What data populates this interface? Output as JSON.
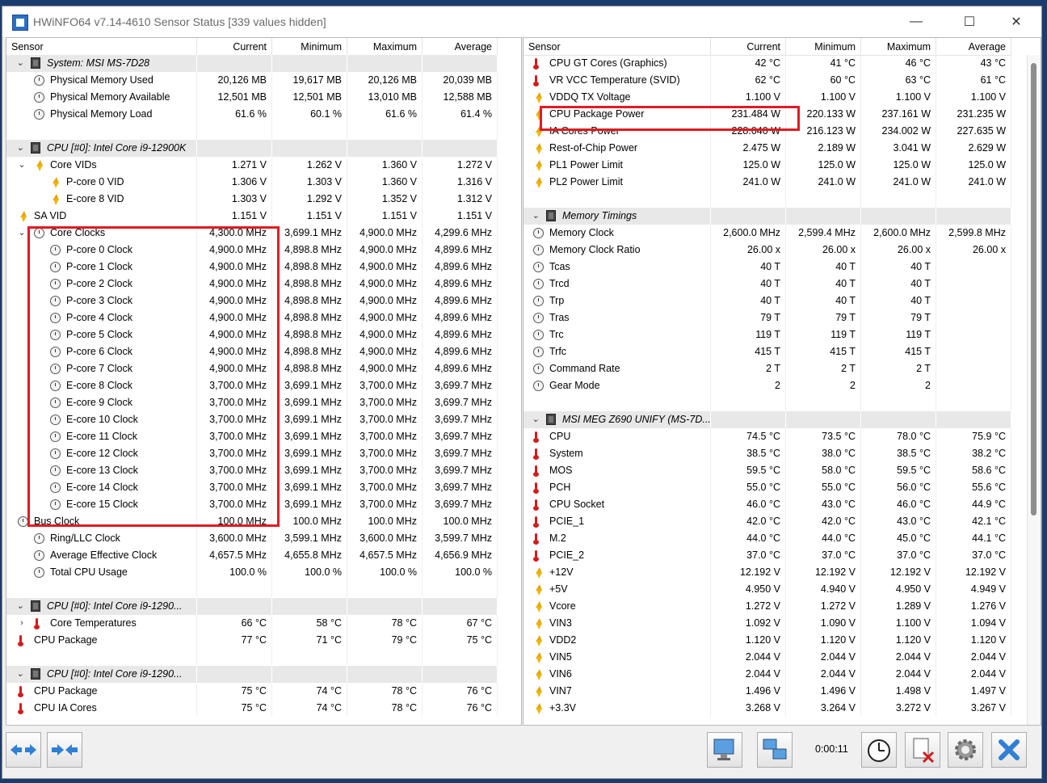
{
  "window": {
    "title": "HWiNFO64 v7.14-4610 Sensor Status [339 values hidden]",
    "controls": {
      "minimize": "—",
      "maximize": "☐",
      "close": "✕"
    }
  },
  "columns": {
    "sensor": "Sensor",
    "current": "Current",
    "minimum": "Minimum",
    "maximum": "Maximum",
    "average": "Average"
  },
  "left_rows": [
    {
      "type": "group",
      "icon": "chip",
      "exp": "v",
      "name": "System: MSI MS-7D28"
    },
    {
      "icon": "clock",
      "indent": 1,
      "name": "Physical Memory Used",
      "cur": "20,126 MB",
      "min": "19,617 MB",
      "max": "20,126 MB",
      "avg": "20,039 MB"
    },
    {
      "icon": "clock",
      "indent": 1,
      "name": "Physical Memory Available",
      "cur": "12,501 MB",
      "min": "12,501 MB",
      "max": "13,010 MB",
      "avg": "12,588 MB"
    },
    {
      "icon": "clock",
      "indent": 1,
      "name": "Physical Memory Load",
      "cur": "61.6 %",
      "min": "60.1 %",
      "max": "61.6 %",
      "avg": "61.4 %"
    },
    {
      "type": "blank"
    },
    {
      "type": "group",
      "icon": "chip",
      "exp": "v",
      "name": "CPU [#0]: Intel Core i9-12900K"
    },
    {
      "icon": "volt",
      "indent": 1,
      "exp": "v",
      "name": "Core VIDs",
      "cur": "1.271 V",
      "min": "1.262 V",
      "max": "1.360 V",
      "avg": "1.272 V"
    },
    {
      "icon": "volt",
      "indent": 2,
      "name": "P-core 0 VID",
      "cur": "1.306 V",
      "min": "1.303 V",
      "max": "1.360 V",
      "avg": "1.316 V"
    },
    {
      "icon": "volt",
      "indent": 2,
      "name": "E-core 8 VID",
      "cur": "1.303 V",
      "min": "1.292 V",
      "max": "1.352 V",
      "avg": "1.312 V"
    },
    {
      "icon": "volt",
      "indent": 0,
      "name": "SA VID",
      "cur": "1.151 V",
      "min": "1.151 V",
      "max": "1.151 V",
      "avg": "1.151 V"
    },
    {
      "icon": "clock",
      "indent": 1,
      "exp": "v",
      "name": "Core Clocks",
      "cur": "4,300.0 MHz",
      "min": "3,699.1 MHz",
      "max": "4,900.0 MHz",
      "avg": "4,299.6 MHz"
    },
    {
      "icon": "clock",
      "indent": 2,
      "name": "P-core 0 Clock",
      "cur": "4,900.0 MHz",
      "min": "4,898.8 MHz",
      "max": "4,900.0 MHz",
      "avg": "4,899.6 MHz"
    },
    {
      "icon": "clock",
      "indent": 2,
      "name": "P-core 1 Clock",
      "cur": "4,900.0 MHz",
      "min": "4,898.8 MHz",
      "max": "4,900.0 MHz",
      "avg": "4,899.6 MHz"
    },
    {
      "icon": "clock",
      "indent": 2,
      "name": "P-core 2 Clock",
      "cur": "4,900.0 MHz",
      "min": "4,898.8 MHz",
      "max": "4,900.0 MHz",
      "avg": "4,899.6 MHz"
    },
    {
      "icon": "clock",
      "indent": 2,
      "name": "P-core 3 Clock",
      "cur": "4,900.0 MHz",
      "min": "4,898.8 MHz",
      "max": "4,900.0 MHz",
      "avg": "4,899.6 MHz"
    },
    {
      "icon": "clock",
      "indent": 2,
      "name": "P-core 4 Clock",
      "cur": "4,900.0 MHz",
      "min": "4,898.8 MHz",
      "max": "4,900.0 MHz",
      "avg": "4,899.6 MHz"
    },
    {
      "icon": "clock",
      "indent": 2,
      "name": "P-core 5 Clock",
      "cur": "4,900.0 MHz",
      "min": "4,898.8 MHz",
      "max": "4,900.0 MHz",
      "avg": "4,899.6 MHz"
    },
    {
      "icon": "clock",
      "indent": 2,
      "name": "P-core 6 Clock",
      "cur": "4,900.0 MHz",
      "min": "4,898.8 MHz",
      "max": "4,900.0 MHz",
      "avg": "4,899.6 MHz"
    },
    {
      "icon": "clock",
      "indent": 2,
      "name": "P-core 7 Clock",
      "cur": "4,900.0 MHz",
      "min": "4,898.8 MHz",
      "max": "4,900.0 MHz",
      "avg": "4,899.6 MHz"
    },
    {
      "icon": "clock",
      "indent": 2,
      "name": "E-core 8 Clock",
      "cur": "3,700.0 MHz",
      "min": "3,699.1 MHz",
      "max": "3,700.0 MHz",
      "avg": "3,699.7 MHz"
    },
    {
      "icon": "clock",
      "indent": 2,
      "name": "E-core 9 Clock",
      "cur": "3,700.0 MHz",
      "min": "3,699.1 MHz",
      "max": "3,700.0 MHz",
      "avg": "3,699.7 MHz"
    },
    {
      "icon": "clock",
      "indent": 2,
      "name": "E-core 10 Clock",
      "cur": "3,700.0 MHz",
      "min": "3,699.1 MHz",
      "max": "3,700.0 MHz",
      "avg": "3,699.7 MHz"
    },
    {
      "icon": "clock",
      "indent": 2,
      "name": "E-core 11 Clock",
      "cur": "3,700.0 MHz",
      "min": "3,699.1 MHz",
      "max": "3,700.0 MHz",
      "avg": "3,699.7 MHz"
    },
    {
      "icon": "clock",
      "indent": 2,
      "name": "E-core 12 Clock",
      "cur": "3,700.0 MHz",
      "min": "3,699.1 MHz",
      "max": "3,700.0 MHz",
      "avg": "3,699.7 MHz"
    },
    {
      "icon": "clock",
      "indent": 2,
      "name": "E-core 13 Clock",
      "cur": "3,700.0 MHz",
      "min": "3,699.1 MHz",
      "max": "3,700.0 MHz",
      "avg": "3,699.7 MHz"
    },
    {
      "icon": "clock",
      "indent": 2,
      "name": "E-core 14 Clock",
      "cur": "3,700.0 MHz",
      "min": "3,699.1 MHz",
      "max": "3,700.0 MHz",
      "avg": "3,699.7 MHz"
    },
    {
      "icon": "clock",
      "indent": 2,
      "name": "E-core 15 Clock",
      "cur": "3,700.0 MHz",
      "min": "3,699.1 MHz",
      "max": "3,700.0 MHz",
      "avg": "3,699.7 MHz"
    },
    {
      "icon": "clock",
      "indent": 0,
      "name": "Bus Clock",
      "cur": "100.0 MHz",
      "min": "100.0 MHz",
      "max": "100.0 MHz",
      "avg": "100.0 MHz"
    },
    {
      "icon": "clock",
      "indent": 1,
      "name": "Ring/LLC Clock",
      "cur": "3,600.0 MHz",
      "min": "3,599.1 MHz",
      "max": "3,600.0 MHz",
      "avg": "3,599.7 MHz"
    },
    {
      "icon": "clock",
      "indent": 1,
      "name": "Average Effective Clock",
      "cur": "4,657.5 MHz",
      "min": "4,655.8 MHz",
      "max": "4,657.5 MHz",
      "avg": "4,656.9 MHz"
    },
    {
      "icon": "clock",
      "indent": 1,
      "name": "Total CPU Usage",
      "cur": "100.0 %",
      "min": "100.0 %",
      "max": "100.0 %",
      "avg": "100.0 %"
    },
    {
      "type": "blank"
    },
    {
      "type": "group",
      "icon": "chip",
      "exp": "v",
      "name": "CPU [#0]: Intel Core i9-1290..."
    },
    {
      "icon": "temp",
      "indent": 1,
      "exp": ">",
      "name": "Core Temperatures",
      "cur": "66 °C",
      "min": "58 °C",
      "max": "78 °C",
      "avg": "67 °C"
    },
    {
      "icon": "temp",
      "indent": 0,
      "name": "CPU Package",
      "cur": "77 °C",
      "min": "71 °C",
      "max": "79 °C",
      "avg": "75 °C"
    },
    {
      "type": "blank"
    },
    {
      "type": "group",
      "icon": "chip",
      "exp": "v",
      "name": "CPU [#0]: Intel Core i9-1290..."
    },
    {
      "icon": "temp",
      "indent": 0,
      "name": "CPU Package",
      "cur": "75 °C",
      "min": "74 °C",
      "max": "78 °C",
      "avg": "76 °C"
    },
    {
      "icon": "temp",
      "indent": 0,
      "name": "CPU IA Cores",
      "cur": "75 °C",
      "min": "74 °C",
      "max": "78 °C",
      "avg": "76 °C"
    }
  ],
  "right_rows": [
    {
      "icon": "temp",
      "name": "CPU GT Cores (Graphics)",
      "cur": "42 °C",
      "min": "41 °C",
      "max": "46 °C",
      "avg": "43 °C"
    },
    {
      "icon": "temp",
      "name": "VR VCC Temperature (SVID)",
      "cur": "62 °C",
      "min": "60 °C",
      "max": "63 °C",
      "avg": "61 °C"
    },
    {
      "icon": "volt",
      "name": "VDDQ TX Voltage",
      "cur": "1.100 V",
      "min": "1.100 V",
      "max": "1.100 V",
      "avg": "1.100 V"
    },
    {
      "icon": "volt",
      "name": "CPU Package Power",
      "cur": "231.484 W",
      "min": "220.133 W",
      "max": "237.161 W",
      "avg": "231.235 W"
    },
    {
      "icon": "volt",
      "name": "IA Cores Power",
      "cur": "228.040 W",
      "min": "216.123 W",
      "max": "234.002 W",
      "avg": "227.635 W"
    },
    {
      "icon": "volt",
      "name": "Rest-of-Chip Power",
      "cur": "2.475 W",
      "min": "2.189 W",
      "max": "3.041 W",
      "avg": "2.629 W"
    },
    {
      "icon": "volt",
      "name": "PL1 Power Limit",
      "cur": "125.0 W",
      "min": "125.0 W",
      "max": "125.0 W",
      "avg": "125.0 W"
    },
    {
      "icon": "volt",
      "name": "PL2 Power Limit",
      "cur": "241.0 W",
      "min": "241.0 W",
      "max": "241.0 W",
      "avg": "241.0 W"
    },
    {
      "type": "blank"
    },
    {
      "type": "group",
      "icon": "chip",
      "exp": "v",
      "name": "Memory Timings"
    },
    {
      "icon": "clock",
      "name": "Memory Clock",
      "cur": "2,600.0 MHz",
      "min": "2,599.4 MHz",
      "max": "2,600.0 MHz",
      "avg": "2,599.8 MHz"
    },
    {
      "icon": "clock",
      "name": "Memory Clock Ratio",
      "cur": "26.00 x",
      "min": "26.00 x",
      "max": "26.00 x",
      "avg": "26.00 x"
    },
    {
      "icon": "clock",
      "name": "Tcas",
      "cur": "40 T",
      "min": "40 T",
      "max": "40 T",
      "avg": ""
    },
    {
      "icon": "clock",
      "name": "Trcd",
      "cur": "40 T",
      "min": "40 T",
      "max": "40 T",
      "avg": ""
    },
    {
      "icon": "clock",
      "name": "Trp",
      "cur": "40 T",
      "min": "40 T",
      "max": "40 T",
      "avg": ""
    },
    {
      "icon": "clock",
      "name": "Tras",
      "cur": "79 T",
      "min": "79 T",
      "max": "79 T",
      "avg": ""
    },
    {
      "icon": "clock",
      "name": "Trc",
      "cur": "119 T",
      "min": "119 T",
      "max": "119 T",
      "avg": ""
    },
    {
      "icon": "clock",
      "name": "Trfc",
      "cur": "415 T",
      "min": "415 T",
      "max": "415 T",
      "avg": ""
    },
    {
      "icon": "clock",
      "name": "Command Rate",
      "cur": "2 T",
      "min": "2 T",
      "max": "2 T",
      "avg": ""
    },
    {
      "icon": "clock",
      "name": "Gear Mode",
      "cur": "2",
      "min": "2",
      "max": "2",
      "avg": ""
    },
    {
      "type": "blank"
    },
    {
      "type": "group",
      "icon": "chip",
      "exp": "v",
      "name": "MSI MEG Z690 UNIFY (MS-7D..."
    },
    {
      "icon": "temp",
      "name": "CPU",
      "cur": "74.5 °C",
      "min": "73.5 °C",
      "max": "78.0 °C",
      "avg": "75.9 °C"
    },
    {
      "icon": "temp",
      "name": "System",
      "cur": "38.5 °C",
      "min": "38.0 °C",
      "max": "38.5 °C",
      "avg": "38.2 °C"
    },
    {
      "icon": "temp",
      "name": "MOS",
      "cur": "59.5 °C",
      "min": "58.0 °C",
      "max": "59.5 °C",
      "avg": "58.6 °C"
    },
    {
      "icon": "temp",
      "name": "PCH",
      "cur": "55.0 °C",
      "min": "55.0 °C",
      "max": "56.0 °C",
      "avg": "55.6 °C"
    },
    {
      "icon": "temp",
      "name": "CPU Socket",
      "cur": "46.0 °C",
      "min": "43.0 °C",
      "max": "46.0 °C",
      "avg": "44.9 °C"
    },
    {
      "icon": "temp",
      "name": "PCIE_1",
      "cur": "42.0 °C",
      "min": "42.0 °C",
      "max": "43.0 °C",
      "avg": "42.1 °C"
    },
    {
      "icon": "temp",
      "name": "M.2",
      "cur": "44.0 °C",
      "min": "44.0 °C",
      "max": "45.0 °C",
      "avg": "44.1 °C"
    },
    {
      "icon": "temp",
      "name": "PCIE_2",
      "cur": "37.0 °C",
      "min": "37.0 °C",
      "max": "37.0 °C",
      "avg": "37.0 °C"
    },
    {
      "icon": "volt",
      "name": "+12V",
      "cur": "12.192 V",
      "min": "12.192 V",
      "max": "12.192 V",
      "avg": "12.192 V"
    },
    {
      "icon": "volt",
      "name": "+5V",
      "cur": "4.950 V",
      "min": "4.940 V",
      "max": "4.950 V",
      "avg": "4.949 V"
    },
    {
      "icon": "volt",
      "name": "Vcore",
      "cur": "1.272 V",
      "min": "1.272 V",
      "max": "1.289 V",
      "avg": "1.276 V"
    },
    {
      "icon": "volt",
      "name": "VIN3",
      "cur": "1.092 V",
      "min": "1.090 V",
      "max": "1.100 V",
      "avg": "1.094 V"
    },
    {
      "icon": "volt",
      "name": "VDD2",
      "cur": "1.120 V",
      "min": "1.120 V",
      "max": "1.120 V",
      "avg": "1.120 V"
    },
    {
      "icon": "volt",
      "name": "VIN5",
      "cur": "2.044 V",
      "min": "2.044 V",
      "max": "2.044 V",
      "avg": "2.044 V"
    },
    {
      "icon": "volt",
      "name": "VIN6",
      "cur": "2.044 V",
      "min": "2.044 V",
      "max": "2.044 V",
      "avg": "2.044 V"
    },
    {
      "icon": "volt",
      "name": "VIN7",
      "cur": "1.496 V",
      "min": "1.496 V",
      "max": "1.498 V",
      "avg": "1.497 V"
    },
    {
      "icon": "volt",
      "name": "+3.3V",
      "cur": "3.268 V",
      "min": "3.264 V",
      "max": "3.272 V",
      "avg": "3.267 V"
    }
  ],
  "toolbar": {
    "timer": "0:00:11",
    "left_buttons": [
      "expand-arrows",
      "collapse-arrows"
    ],
    "right_buttons": [
      "report",
      "network",
      "clock",
      "reset",
      "settings",
      "close"
    ]
  },
  "colors": {
    "highlight": "#e01b24",
    "group_bg": "#e8e8e8",
    "desktop": "#1b3d6e"
  }
}
